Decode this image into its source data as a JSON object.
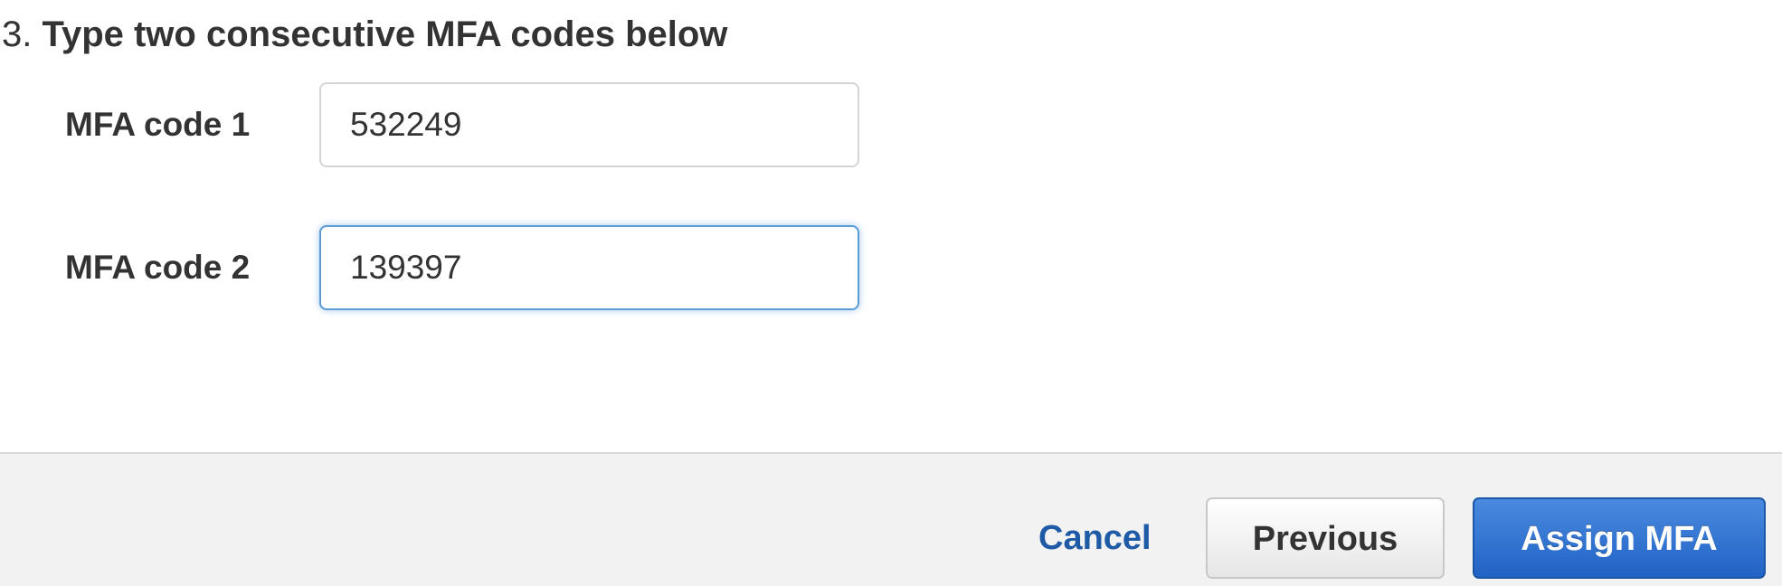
{
  "step": {
    "number": "3.",
    "title": "Type two consecutive MFA codes below"
  },
  "fields": [
    {
      "label": "MFA code 1",
      "value": "532249"
    },
    {
      "label": "MFA code 2",
      "value": "139397"
    }
  ],
  "footer": {
    "cancel_label": "Cancel",
    "previous_label": "Previous",
    "assign_label": "Assign MFA"
  },
  "colors": {
    "primary_button": "#2063c4",
    "link": "#1f5aa6",
    "focus_ring": "#5b9dd9",
    "footer_background": "#f2f2f2"
  }
}
